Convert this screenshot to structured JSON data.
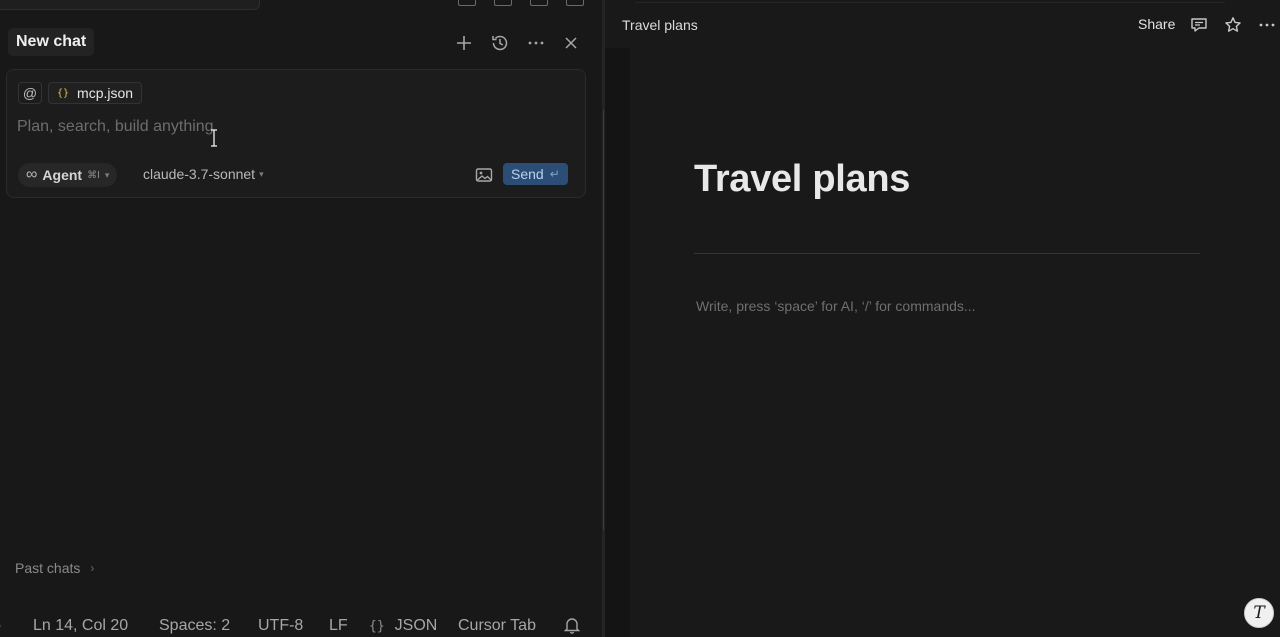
{
  "chat": {
    "title": "New chat",
    "context_file": "mcp.json",
    "prompt_placeholder": "Plan, search, build anything",
    "mode": {
      "label": "Agent",
      "shortcut": "⌘I"
    },
    "model": "claude-3.7-sonnet",
    "send_label": "Send",
    "past_chats_label": "Past chats"
  },
  "statusbar": {
    "position": "Ln 14, Col 20",
    "spaces": "Spaces: 2",
    "encoding": "UTF-8",
    "eol": "LF",
    "language": "JSON",
    "cursor_tab": "Cursor Tab"
  },
  "doc": {
    "header_title": "Travel plans",
    "share_label": "Share",
    "title": "Travel plans",
    "editor_placeholder": "Write, press ‘space’ for AI, ‘/’ for commands..."
  },
  "icons": {
    "header": [
      "plus-icon",
      "history-icon",
      "more-icon",
      "close-icon"
    ],
    "composer": [
      "at-icon",
      "json-file-icon",
      "infinity-icon",
      "image-icon",
      "return-icon"
    ],
    "doc_header": [
      "comment-icon",
      "star-icon",
      "more-icon"
    ]
  },
  "colors": {
    "send_bg": "#2c4d75",
    "send_text": "#b9d3f1",
    "json_icon": "#d9c34a"
  }
}
